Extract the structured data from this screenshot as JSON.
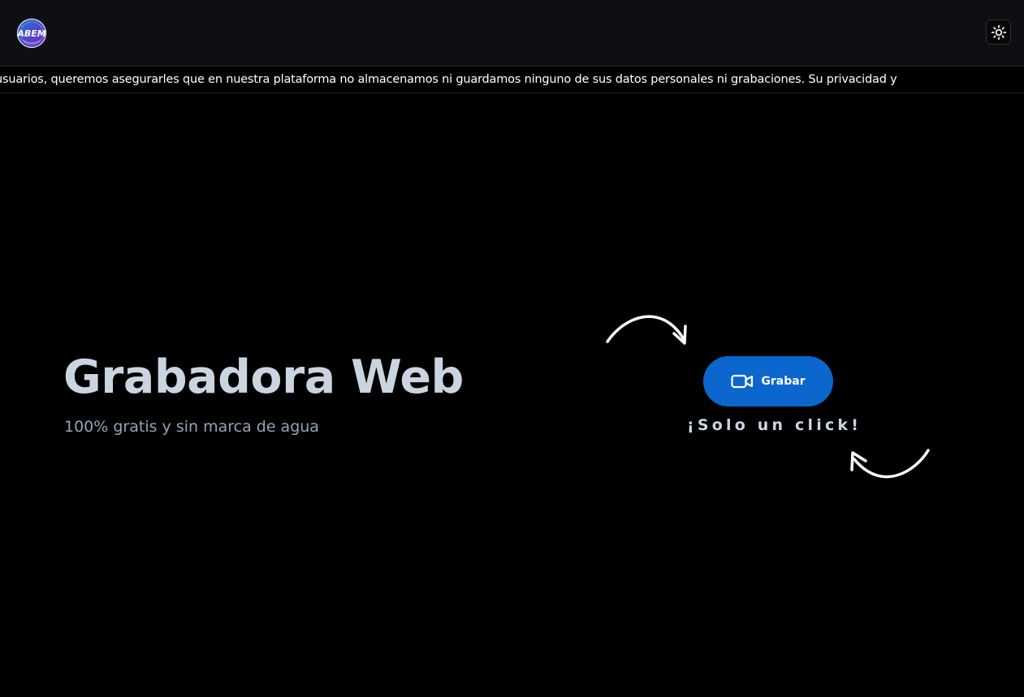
{
  "header": {
    "logo_text": "ABEM",
    "logo_icon": "logo-badge",
    "theme_toggle_icon": "sun-icon"
  },
  "notice": {
    "text": "usuarios, queremos asegurarles que en nuestra plataforma no almacenamos ni guardamos ninguno de sus datos personales ni grabaciones. Su privacidad y"
  },
  "hero": {
    "title": "Grabadora Web",
    "subtitle": "100% gratis y sin marca de agua"
  },
  "record": {
    "icon": "video-camera-icon",
    "label": "Grabar",
    "tagline": "¡Solo un click!"
  },
  "colors": {
    "background": "#000000",
    "header_background": "#0e0f12",
    "primary_button": "#0b66cd",
    "title_text": "#cbd5e1",
    "subtitle_text": "#94a3b8"
  }
}
